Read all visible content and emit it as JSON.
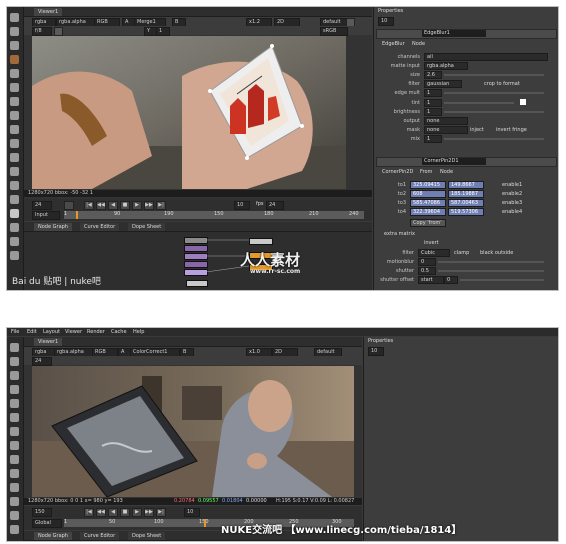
{
  "screenshot1": {
    "viewer": {
      "tab": "Viewer1",
      "channel1": "rgba",
      "channel2": "rgba.alpha",
      "colorspace": "RGB",
      "input_a": "A",
      "node_a": "Merge1",
      "input_b": "B",
      "zoom": "x1.2",
      "view": "2D",
      "lut": "default",
      "space": "sRGB",
      "gain": "f/8",
      "gamma": "1",
      "y_label": "Y",
      "frame_field": "24",
      "status": "1280x720 bbox: -50 -32 1"
    },
    "timeline": {
      "fps_label": "fps",
      "fps": "24",
      "frame": "24",
      "step": "10",
      "range_mode": "Input",
      "ticks": [
        "1",
        "90",
        "190",
        "150",
        "180",
        "210",
        "240"
      ]
    },
    "nodegraph": {
      "tabs": [
        "Node Graph",
        "Curve Editor",
        "Dope Sheet"
      ]
    },
    "properties": {
      "title": "Properties",
      "count": "10",
      "panel1": {
        "name": "EdgeBlur1",
        "tabs": [
          "EdgeBlur",
          "Node"
        ],
        "rows": [
          {
            "label": "channels",
            "value": "all"
          },
          {
            "label": "matte input",
            "value": "rgba.alpha"
          },
          {
            "label": "size",
            "value": "2.6"
          },
          {
            "label": "filter",
            "value": "gaussian",
            "extra": "crop to format"
          },
          {
            "label": "edge mult",
            "value": "1"
          },
          {
            "label": "tint",
            "value": "1"
          },
          {
            "label": "brightness",
            "value": "1"
          },
          {
            "label": "output",
            "value": "none"
          },
          {
            "label": "mask",
            "value": "none",
            "extra": "invert  fringe",
            "extra2": "inject"
          },
          {
            "label": "mix",
            "value": "1"
          }
        ]
      },
      "panel2": {
        "name": "CornerPin2D1",
        "tabs": [
          "CornerPin2D",
          "From",
          "Node"
        ],
        "corners": [
          {
            "label": "to1",
            "x": "325.09415",
            "y": "149.8667",
            "enable": "enable1"
          },
          {
            "label": "to2",
            "x": "608",
            "y": "185.19887",
            "enable": "enable2"
          },
          {
            "label": "to3",
            "x": "585.47086",
            "y": "587.00463",
            "enable": "enable3"
          },
          {
            "label": "to4",
            "x": "322.39604",
            "y": "519.57306",
            "enable": "enable4"
          }
        ],
        "copy_button": "Copy 'from'",
        "extra_matrix": "extra matrix",
        "invert": "invert",
        "filter_label": "filter",
        "filter": "Cubic",
        "clamp": "clamp",
        "black_outside": "black outside",
        "motionblur_label": "motionblur",
        "motionblur": "0",
        "shutter_label": "shutter",
        "shutter": "0.5",
        "shutter_offset_label": "shutter offset",
        "shutter_offset": "start",
        "shutter_offset_value": "0"
      }
    },
    "watermark_left": "Bai du 贴吧 | nuke吧",
    "watermark_center": "人人素材",
    "watermark_url": "www.rr-sc.com"
  },
  "screenshot2": {
    "menubar": [
      "File",
      "Edit",
      "Layout",
      "Viewer",
      "Render",
      "Cache",
      "Help"
    ],
    "viewer": {
      "tab": "Viewer1",
      "channel1": "rgba",
      "channel2": "rgba.alpha",
      "colorspace": "RGB",
      "input_a": "A",
      "node_a": "ColorCorrect1",
      "input_b": "B",
      "zoom": "x1.0",
      "view": "2D",
      "lut": "default",
      "frame_field": "24",
      "status_left": "1280x720  bbox: 0 0 1  x= 980 y= 193",
      "status_vals": [
        "0.20784",
        "0.09557",
        "0.01804",
        "0.00000"
      ],
      "status_right": "H:195 S:0.17 V:0.09  L: 0.00827"
    },
    "timeline": {
      "frame": "150",
      "range_mode": "Global",
      "step": "10",
      "ticks": [
        "1",
        "50",
        "100",
        "150",
        "200",
        "250",
        "300"
      ]
    },
    "nodegraph": {
      "tabs": [
        "Node Graph",
        "Curve Editor",
        "Dope Sheet"
      ]
    },
    "properties": {
      "title": "Properties",
      "count": "10"
    },
    "watermark": "NUKE交流吧 【www.linecg.com/tieba/1814】"
  },
  "colors": {
    "ui_bg": "#3a3a3a",
    "field_bg": "#2a2a2a",
    "highlight": "#6f7fb4",
    "accent_orange": "#e39a2a",
    "panel_head": "#4b4b4b"
  }
}
